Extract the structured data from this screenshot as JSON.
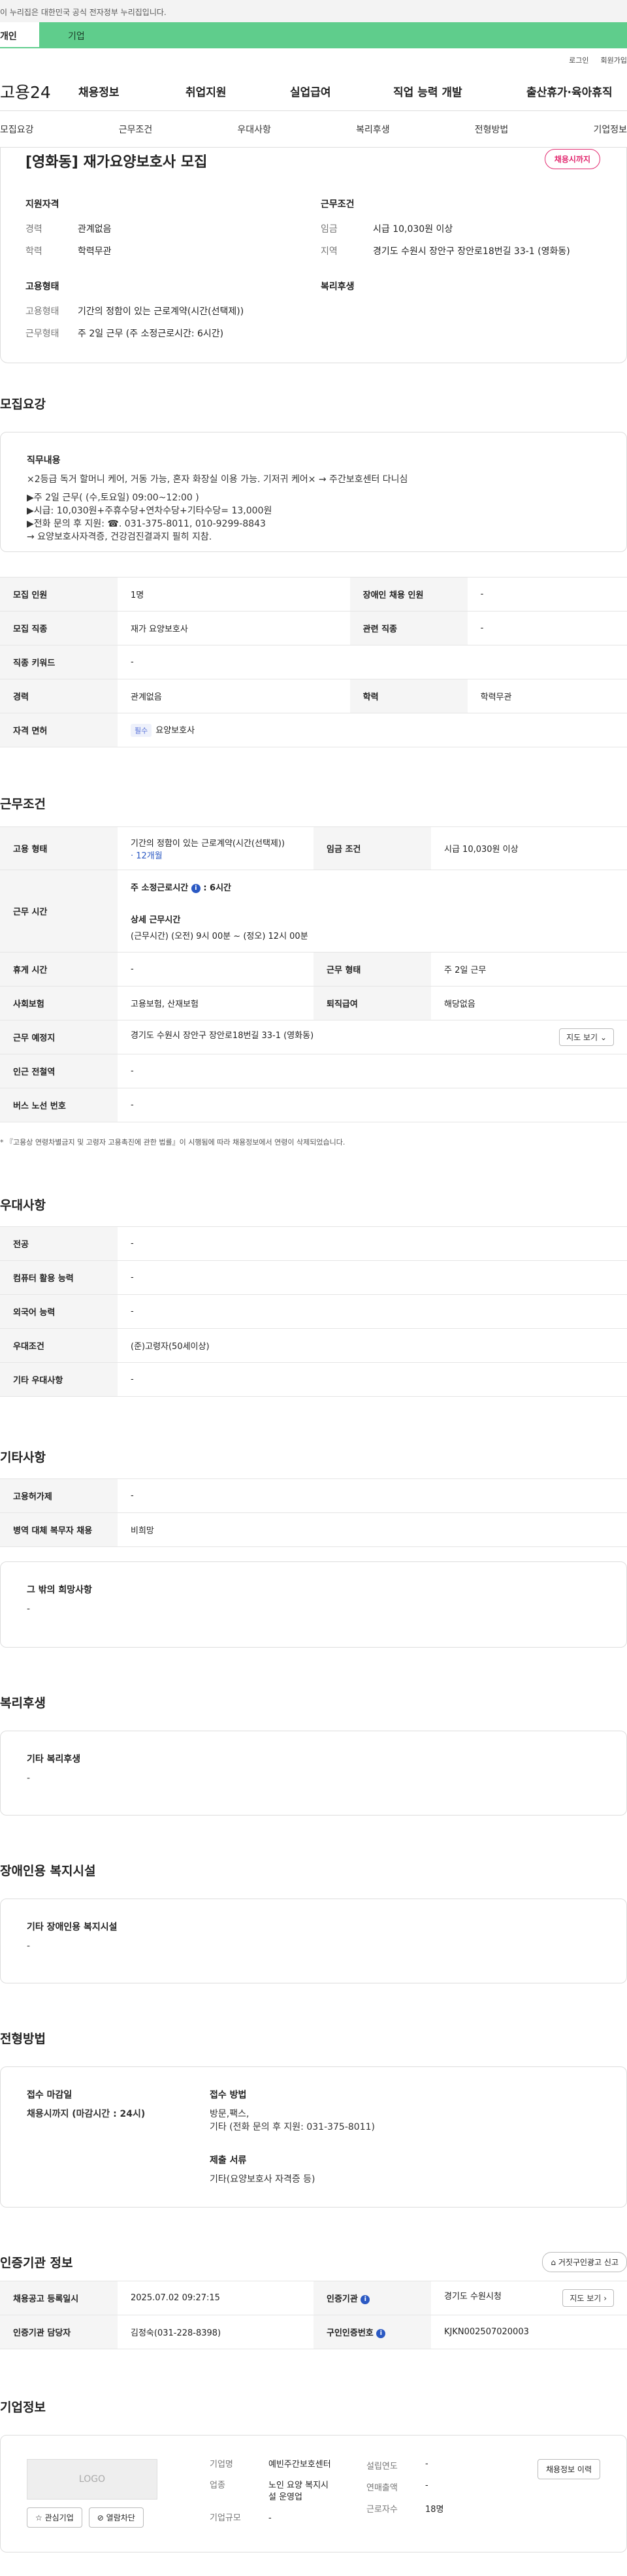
{
  "gov_notice": "이 누리집은 대한민국 공식 전자정부 누리집입니다.",
  "usertabs": {
    "personal": "개인",
    "company": "기업"
  },
  "util": {
    "login": "로그인",
    "join": "회원가입"
  },
  "gnb": {
    "logo": "고용24",
    "items": [
      "채용정보",
      "취업지원",
      "실업급여",
      "직업 능력 개발",
      "출산휴가·육아휴직"
    ]
  },
  "subnav": [
    "모집요강",
    "근무조건",
    "우대사항",
    "복리후생",
    "전형방법",
    "기업정보"
  ],
  "summary": {
    "title": "[영화동] 재가요양보호사 모집",
    "status": "채용시까지",
    "qual_title": "지원자격",
    "career_k": "경력",
    "career_v": "관계없음",
    "edu_k": "학력",
    "edu_v": "학력무관",
    "emp_title": "고용형태",
    "emp_k": "고용형태",
    "emp_v": "기간의 정함이 있는 근로계약(시간(선택제))",
    "work_k": "근무형태",
    "work_v": "주 2일 근무 (주 소정근로시간: 6시간)",
    "cond_title": "근무조건",
    "wage_k": "임금",
    "wage_v": "시급 10,030원 이상",
    "area_k": "지역",
    "area_v": "경기도 수원시 장안구 장안로18번길 33-1 (영화동)",
    "welfare_title": "복리후생"
  },
  "recruit": {
    "title": "모집요강",
    "duty_title": "직무내용",
    "duty_lines": [
      "×2등급 독거 할머니 케어, 거동 가능, 혼자 화장실 이용 가능. 기저귀 케어× → 주간보호센터 다니심",
      "",
      "▶주 2일 근무( (수,토요일) 09:00~12:00 )",
      "▶시급: 10,030원+주휴수당+연차수당+기타수당= 13,000원",
      "▶전화 문의 후 지원: ☎. 031-375-8011, 010-9299-8843",
      "→ 요양보호사자격증, 건강검진결과지 필히 지참."
    ],
    "rows": [
      [
        "모집 인원",
        "1명",
        "장애인 채용 인원",
        "-"
      ],
      [
        "모집 직종",
        "재가 요양보호사",
        "관련 직종",
        "-"
      ],
      [
        "직종 키워드",
        "-"
      ],
      [
        "경력",
        "관계없음",
        "학력",
        "학력무관"
      ]
    ],
    "license_k": "자격 면허",
    "license_tag": "필수",
    "license_v": "요양보호사"
  },
  "work": {
    "title": "근무조건",
    "emp_k": "고용 형태",
    "emp_v": "기간의 정함이 있는 근로계약(시간(선택제))",
    "emp_v2": "· 12개월",
    "wage_k": "임금 조건",
    "wage_v": "시급 10,030원 이상",
    "time_k": "근무 시간",
    "time_l1": "주 소정근로시간",
    "time_l1v": ": 6시간",
    "time_l2": "상세 근무시간",
    "time_l3": "(근무시간) (오전) 9시 00분 ~ (정오) 12시 00분",
    "rest_k": "휴게 시간",
    "rest_v": "-",
    "form_k": "근무 형태",
    "form_v": "주 2일 근무",
    "ins_k": "사회보험",
    "ins_v": "고용보험, 산재보험",
    "ret_k": "퇴직급여",
    "ret_v": "해당없음",
    "place_k": "근무 예정지",
    "place_v": "경기도 수원시 장안구 장안로18번길 33-1 (영화동)",
    "map_btn": "지도 보기",
    "sub_k": "인근 전철역",
    "sub_v": "-",
    "bus_k": "버스 노선 번호",
    "bus_v": "-",
    "note": "* 『고용상 연령차별금지 및 고령자 고용촉진에 관한 법률』이 시행됨에 따라 채용정보에서 연령이 삭제되었습니다."
  },
  "pref": {
    "title": "우대사항",
    "rows": [
      [
        "전공",
        "-"
      ],
      [
        "컴퓨터 활용 능력",
        "-"
      ],
      [
        "외국어 능력",
        "-"
      ],
      [
        "우대조건",
        "(준)고령자(50세이상)"
      ],
      [
        "기타 우대사항",
        "-"
      ]
    ]
  },
  "etc": {
    "title": "기타사항",
    "rows": [
      [
        "고용허가제",
        "-"
      ],
      [
        "병역 대체 복무자 채용",
        "비희망"
      ]
    ],
    "wish_title": "그 밖의 희망사항",
    "wish_v": "-"
  },
  "welfare": {
    "title": "복리후생",
    "sub": "기타 복리후생",
    "v": "-"
  },
  "disab": {
    "title": "장애인용 복지시설",
    "sub": "기타 장애인용 복지시설",
    "v": "-"
  },
  "screen": {
    "title": "전형방법",
    "deadline_k": "접수 마감일",
    "deadline_v": "채용시까지 (마감시간 : 24시)",
    "method_k": "접수 방법",
    "method_v1": "방문,팩스,",
    "method_v2": "기타 (전화 문의 후 지원: 031-375-8011)",
    "doc_k": "제출 서류",
    "doc_v": "기타(요양보호사 자격증 등)"
  },
  "cert": {
    "title": "인증기관 정보",
    "report_btn": "거짓구인광고 신고",
    "reg_k": "채용공고 등록일시",
    "reg_v": "2025.07.02 09:27:15",
    "org_k": "인증기관",
    "org_v": "경기도 수원시청",
    "map_btn": "지도 보기",
    "mgr_k": "인증기관 담당자",
    "mgr_v": "김정숙(031-228-8398)",
    "num_k": "구인인증번호",
    "num_v": "KJKN002507020003"
  },
  "company": {
    "title": "기업정보",
    "logo": "LOGO",
    "fav_btn": "관심기업",
    "block_btn": "열람차단",
    "hist_btn": "채용정보 이력",
    "name_k": "기업명",
    "name_v": "예빈주간보호센터",
    "ind_k": "업종",
    "ind_v1": "노인 요양 복지시",
    "ind_v2": "설 운영업",
    "size_k": "기업규모",
    "size_v": "-",
    "year_k": "설립연도",
    "year_v": "-",
    "sales_k": "연매출액",
    "sales_v": "-",
    "emp_k": "근로자수",
    "emp_v": "18명"
  }
}
